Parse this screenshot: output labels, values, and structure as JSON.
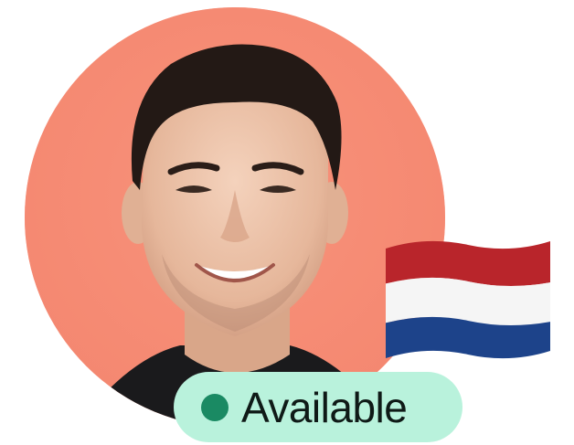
{
  "profile": {
    "avatar_icon": "person-photo",
    "avatar_bg_color": "#f48770",
    "flag_icon": "netherlands-flag-icon",
    "flag_colors": [
      "#c1272d",
      "#ffffff",
      "#1f4690"
    ],
    "status": {
      "label": "Available",
      "dot_color": "#1a8a63",
      "badge_bg_color": "#b9f2dc"
    }
  }
}
